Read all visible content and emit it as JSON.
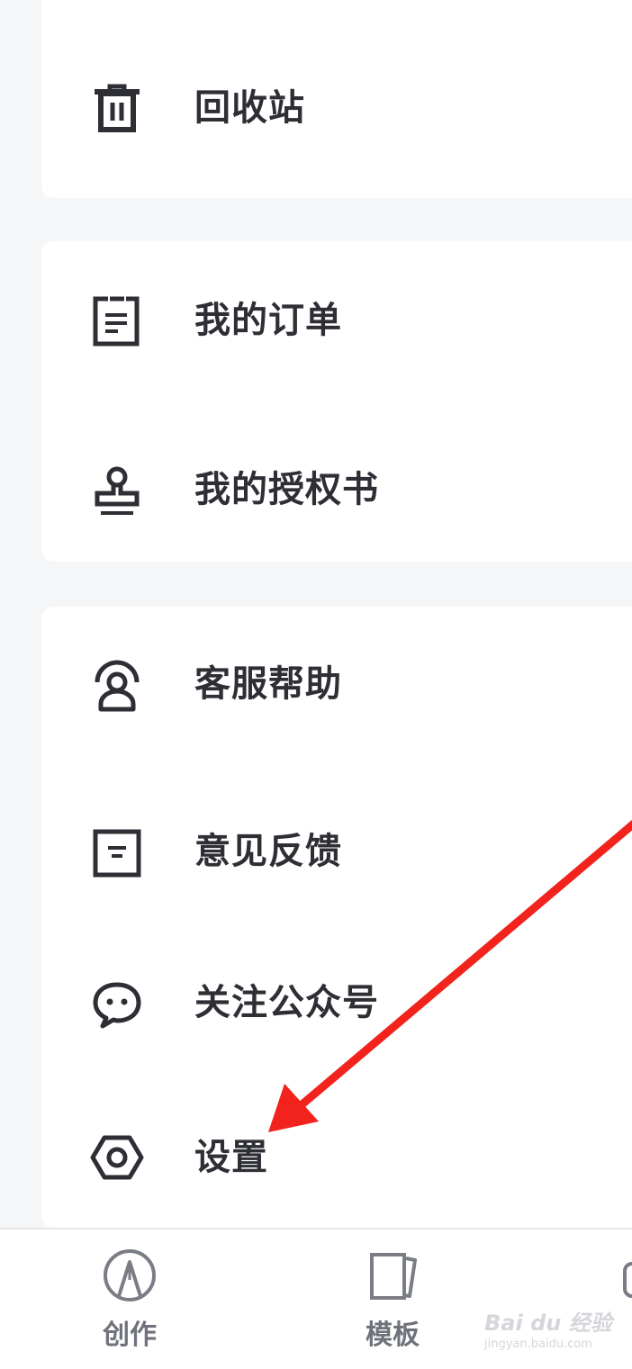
{
  "menu": {
    "group1": [
      {
        "label": "回收站",
        "icon": "trash-icon"
      }
    ],
    "group2": [
      {
        "label": "我的订单",
        "icon": "order-icon"
      },
      {
        "label": "我的授权书",
        "icon": "stamp-icon"
      }
    ],
    "group3": [
      {
        "label": "客服帮助",
        "icon": "customer-service-icon"
      },
      {
        "label": "意见反馈",
        "icon": "feedback-icon"
      },
      {
        "label": "关注公众号",
        "icon": "chat-bubble-icon"
      },
      {
        "label": "设置",
        "icon": "settings-icon"
      }
    ]
  },
  "tabbar": {
    "tabs": [
      {
        "label": "创作",
        "icon": "create-pen-icon"
      },
      {
        "label": "模板",
        "icon": "template-icon"
      }
    ]
  },
  "watermark": {
    "logo": "Bai du 经验",
    "url": "jingyan.baidu.com"
  },
  "annotation": {
    "color": "#f2231c",
    "icon": "red-arrow-pointing-to-settings"
  },
  "colors": {
    "background": "#f5f6f8",
    "card": "#ffffff",
    "text": "#2d2f35",
    "icon": "#2d2f35",
    "tab_text": "#6f727a"
  }
}
